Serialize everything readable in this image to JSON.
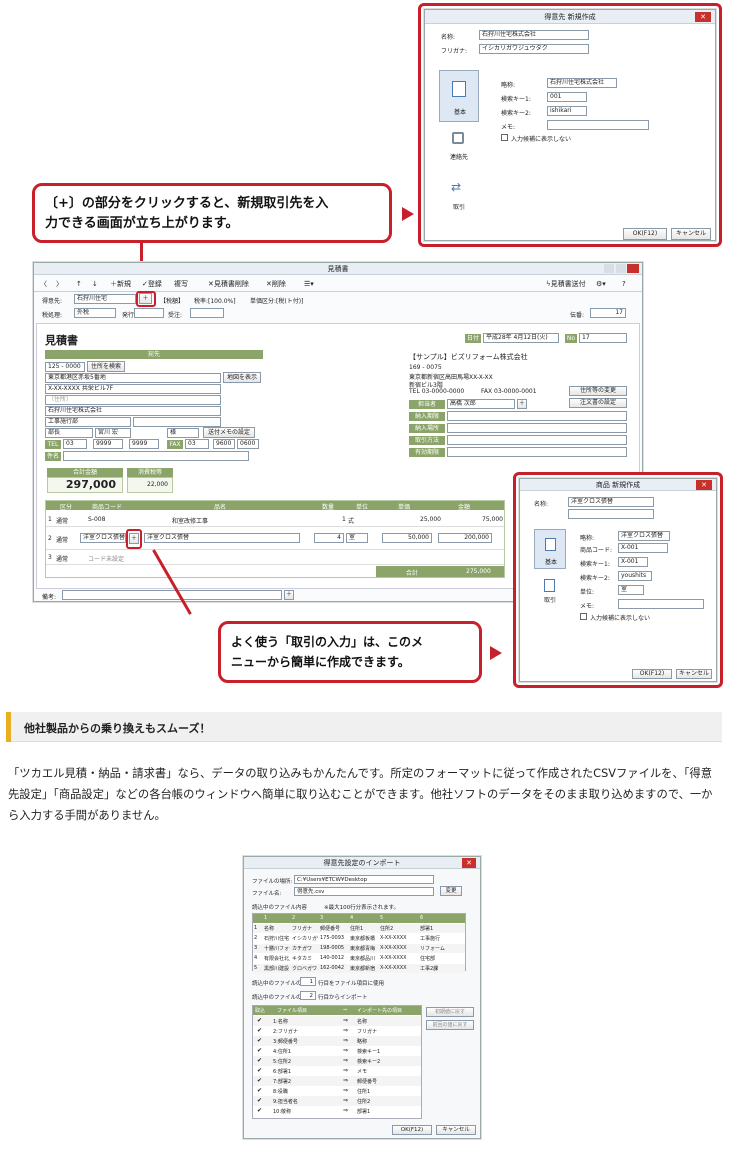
{
  "top_dialog": {
    "title": "得意先 新規作成",
    "name_label": "名称:",
    "name_value": "石狩川住宅株式会社",
    "kana_label": "フリガナ:",
    "kana_value": "イシカリガワジュウタク",
    "side_tabs": [
      "基本",
      "連絡先",
      "取引"
    ],
    "short_label": "略称:",
    "short_value": "石狩川住宅株式会社",
    "key1_label": "検索キー1:",
    "key1_value": "001",
    "key2_label": "検索キー2:",
    "key2_value": "ishikari",
    "memo_label": "メモ:",
    "hide_label": "入力候補に表示しない",
    "ok": "OK(F12)",
    "cancel": "キャンセル"
  },
  "callout1": {
    "line1": "〔+〕の部分をクリックすると、新規取引先を入",
    "line2": "力できる画面が立ち上がります。"
  },
  "main": {
    "title": "見積書",
    "toolbar": [
      "新規",
      "登録",
      "複写",
      "見積書削除",
      "削除"
    ],
    "toolbar_right": "見積書送付",
    "row1": {
      "customer_label": "得意先:",
      "customer_value": "石狩川住宅",
      "badge": "【税額】",
      "tax": "税率:[100.0%]",
      "round": "単価区分:[税(ト付)]"
    },
    "row2": {
      "tax_calc": "税処理:",
      "tax_calc_v": "外税",
      "issue": "発行:",
      "order": "受注:",
      "page_label": "伝番:",
      "page_value": "17"
    },
    "doc_title": "見積書",
    "date_label": "日付",
    "date_value": "平成28年 4月12日(火)",
    "no_label": "No",
    "no_value": "17",
    "dest_header": "宛先",
    "addr": [
      "125 - 0000",
      "東京都港区赤坂5番地",
      "X-XX-XXXX 共栄ビル7F",
      "（住所）",
      "石狩川住宅株式会社",
      "工事施行部"
    ],
    "zip_btn": "住所を検索",
    "map_btn": "地図を表示",
    "title_person": "部長",
    "person": "宮川 宏",
    "honor": "様",
    "send_memo": "送付メモの設定",
    "tel_label": "TEL",
    "tel1": "03",
    "tel2": "9999",
    "tel3": "9999",
    "fax_label": "FAX",
    "fax1": "03",
    "fax2": "9600",
    "fax3": "0600",
    "subject_label": "件名",
    "company": "【サンプル】ビズリフォーム株式会社",
    "c_zip": "169 - 0075",
    "c_addr1": "東京都新宿区高田馬場XX-X-XX",
    "c_addr2": "新宿ビル3階",
    "c_tel": "TEL 03-0000-0000",
    "c_fax": "FAX 03-0000-0001",
    "c_btn1": "住所等の変更",
    "c_btn2": "注文書の設定",
    "staff_rows": [
      "担当者",
      "納入期限",
      "納入場所",
      "取引方法",
      "有効期限"
    ],
    "staff_value": "高橋 次郎",
    "total_label": "合計金額",
    "total_value": "297,000",
    "tax_label": "消費税等",
    "tax_value": "22,000",
    "cols": [
      "区分",
      "商品コード",
      "品名",
      "数量",
      "単位",
      "単価",
      "金額"
    ],
    "rows": [
      {
        "n": "1",
        "kind": "通常",
        "code": "S-008",
        "name": "和室改修工事",
        "qty": "1",
        "unit": "式",
        "price": "25,000",
        "amount": "75,000"
      },
      {
        "n": "2",
        "kind": "通常",
        "code": "洋室クロス張替",
        "name": "洋室クロス張替",
        "qty": "4",
        "unit": "室",
        "price": "50,000",
        "amount": "200,000"
      },
      {
        "n": "3",
        "kind": "通常",
        "code": "コード未設定",
        "name": "",
        "qty": "",
        "unit": "",
        "price": "",
        "amount": ""
      }
    ],
    "sum_label": "合計",
    "sum_value": "275,000",
    "memo_label": "備考:"
  },
  "mid_dialog": {
    "title": "商品 新規作成",
    "name_label": "名称:",
    "name_value": "洋室クロス張替",
    "short_label": "略称:",
    "short_value": "洋室クロス張替",
    "code_label": "商品コード:",
    "code_value": "X-001",
    "key1_label": "検索キー1:",
    "key1_value": "X-001",
    "key2_label": "検索キー2:",
    "key2_value": "youshits",
    "unit_label": "単位:",
    "unit_value": "室",
    "memo_label": "メモ:",
    "hide_label": "入力候補に表示しない",
    "side_tabs": [
      "基本",
      "取引"
    ],
    "ok": "OK(F12)",
    "cancel": "キャンセル"
  },
  "callout2": {
    "line1": "よく使う「取引の入力」は、このメ",
    "line2": "ニューから簡単に作成できます。"
  },
  "section": {
    "heading": "他社製品からの乗り換えもスムーズ！",
    "para": "「ツカエル見積・納品・請求書」なら、データの取り込みもかんたんです。所定のフォーマットに従って作成されたCSVファイルを、「得意先設定」「商品設定」などの各台帳のウィンドウへ簡単に取り込むことができます。他社ソフトのデータをそのまま取り込めますので、一から入力する手間がありません。"
  },
  "import_dialog": {
    "title": "得意先設定のインポート",
    "place_label": "ファイルの場所:",
    "place_value": "C:¥Users¥ETCW¥Desktop",
    "file_label": "ファイル名:",
    "file_value": "得意先.csv",
    "change_btn": "変更",
    "content_label": "読込中のファイル内容",
    "content_note": "※最大100行分表示されます。",
    "grid_head": [
      "",
      "1",
      "2",
      "3",
      "4",
      "5",
      "6"
    ],
    "grid_rows": [
      [
        "1",
        "名称",
        "フリガナ",
        "郵便番号",
        "住所1",
        "住所2",
        "部署1"
      ],
      [
        "2",
        "石狩川住宅",
        "イシカリガワ",
        "175-0093",
        "東京都板橋",
        "X-XX-XXXX",
        "工事施行"
      ],
      [
        "3",
        "十勝川フォート",
        "カチガワ",
        "198-0005",
        "東京都青梅",
        "X-XX-XXXX",
        "リフォーム"
      ],
      [
        "4",
        "有限会社北上",
        "キタカミ",
        "140-0012",
        "東京都品川",
        "X-XX-XXXX",
        "住宅部"
      ],
      [
        "5",
        "黒部川建設",
        "クロベガワ",
        "162-0042",
        "東京都新宿",
        "X-XX-XXXX",
        "工事2課"
      ]
    ],
    "use_row_pre": "読込中のファイルの",
    "use_row_val": "1",
    "use_row_post": "行目をファイル項目に使用",
    "start_row_pre": "読込中のファイルの",
    "start_row_val": "2",
    "start_row_post": "行目からインポート",
    "map_head": [
      "取込",
      "ファイル項目",
      "⇒",
      "インポート先の項目"
    ],
    "map_rows": [
      [
        "1:名称",
        "名称"
      ],
      [
        "2:フリガナ",
        "フリガナ"
      ],
      [
        "3:郵便番号",
        "略称"
      ],
      [
        "4:住所1",
        "検索キー1"
      ],
      [
        "5:住所2",
        "検索キー2"
      ],
      [
        "6:部署1",
        "メモ"
      ],
      [
        "7:部署2",
        "郵便番号"
      ],
      [
        "8:役職",
        "住所1"
      ],
      [
        "9:担当者名",
        "住所2"
      ],
      [
        "10:敬称",
        "部署1"
      ]
    ],
    "init_btn": "初期値に戻す",
    "prev_btn": "前回の値に戻す",
    "ok": "OK(F12)",
    "cancel": "キャンセル"
  }
}
